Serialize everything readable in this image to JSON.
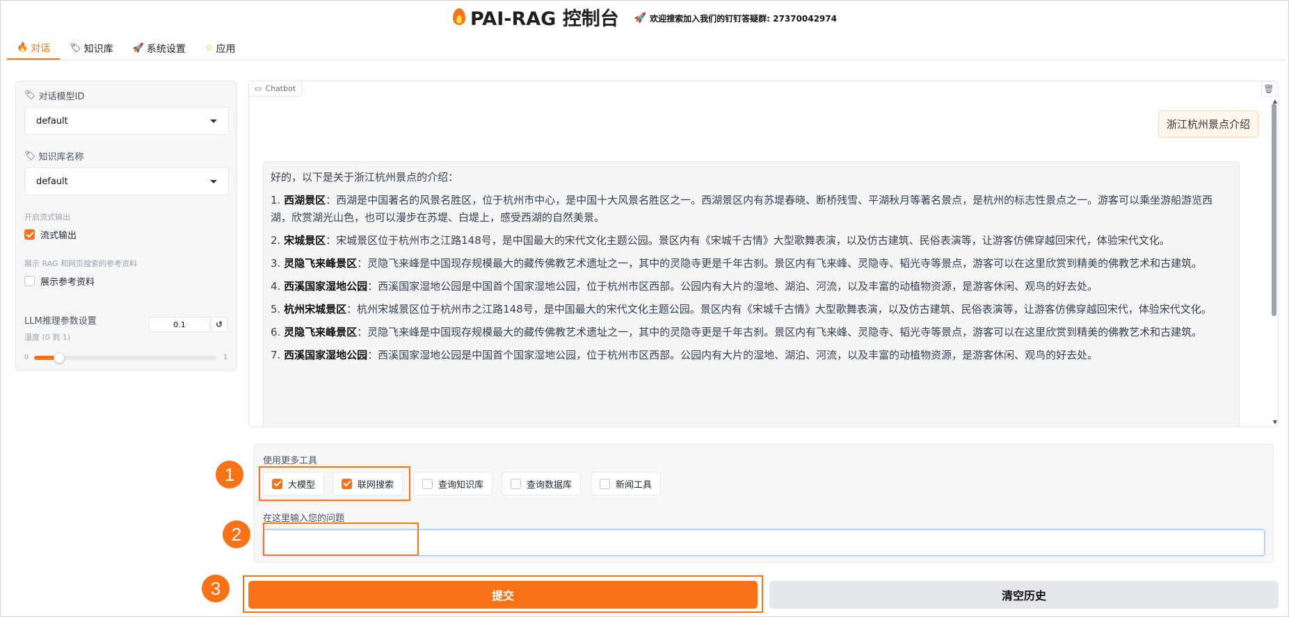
{
  "header": {
    "title": "PAI-RAG 控制台",
    "notice": "欢迎搜索加入我们的钉钉答疑群: 27370042974"
  },
  "tabs": [
    {
      "label": "对话",
      "icon": "flame-icon"
    },
    {
      "label": "知识库",
      "icon": "tag-icon"
    },
    {
      "label": "系统设置",
      "icon": "rocket-icon"
    },
    {
      "label": "应用",
      "icon": "star-icon"
    }
  ],
  "sidebar": {
    "model_label": "对话模型ID",
    "model_value": "default",
    "kb_label": "知识库名称",
    "kb_value": "default",
    "stream_section": "开启流式输出",
    "stream_label": "流式输出",
    "ref_section": "展示 RAG 和网页搜索的参考资料",
    "ref_label": "展示参考资料",
    "llm_label": "LLM推理参数设置",
    "temp_label": "温度 (0 到 1)",
    "temp_value": "0.1",
    "temp_min": "0",
    "temp_max": "1",
    "temp_level": 0.1
  },
  "chat": {
    "label": "Chatbot",
    "user_message": "浙江杭州景点介绍",
    "bot_intro": "好的，以下是关于浙江杭州景点的介绍：",
    "items": [
      {
        "num": "1.",
        "name": "西湖景区",
        "text": "：西湖是中国著名的风景名胜区，位于杭州市中心，是中国十大风景名胜区之一。西湖景区内有苏堤春晓、断桥残雪、平湖秋月等著名景点，是杭州的标志性景点之一。游客可以乘坐游船游览西湖，欣赏湖光山色，也可以漫步在苏堤、白堤上，感受西湖的自然美景。"
      },
      {
        "num": "2.",
        "name": "宋城景区",
        "text": "：宋城景区位于杭州市之江路148号，是中国最大的宋代文化主题公园。景区内有《宋城千古情》大型歌舞表演，以及仿古建筑、民俗表演等，让游客仿佛穿越回宋代，体验宋代文化。"
      },
      {
        "num": "3.",
        "name": "灵隐飞来峰景区",
        "text": "：灵隐飞来峰是中国现存规模最大的藏传佛教艺术遗址之一，其中的灵隐寺更是千年古刹。景区内有飞来峰、灵隐寺、韬光寺等景点，游客可以在这里欣赏到精美的佛教艺术和古建筑。"
      },
      {
        "num": "4.",
        "name": "西溪国家湿地公园",
        "text": "：西溪国家湿地公园是中国首个国家湿地公园，位于杭州市区西部。公园内有大片的湿地、湖泊、河流，以及丰富的动植物资源，是游客休闲、观鸟的好去处。"
      },
      {
        "num": "5.",
        "name": "杭州宋城景区",
        "text": "：杭州宋城景区位于杭州市之江路148号，是中国最大的宋代文化主题公园。景区内有《宋城千古情》大型歌舞表演，以及仿古建筑、民俗表演等，让游客仿佛穿越回宋代，体验宋代文化。"
      },
      {
        "num": "6.",
        "name": "灵隐飞来峰景区",
        "text": "：灵隐飞来峰是中国现存规模最大的藏传佛教艺术遗址之一，其中的灵隐寺更是千年古刹。景区内有飞来峰、灵隐寺、韬光寺等景点，游客可以在这里欣赏到精美的佛教艺术和古建筑。"
      },
      {
        "num": "7.",
        "name": "西溪国家湿地公园",
        "text": "：西溪国家湿地公园是中国首个国家湿地公园，位于杭州市区西部。公园内有大片的湿地、湖泊、河流，以及丰富的动植物资源，是游客休闲、观鸟的好去处。"
      }
    ]
  },
  "tools": {
    "title": "使用更多工具",
    "options": [
      {
        "label": "大模型",
        "checked": true
      },
      {
        "label": "联网搜索",
        "checked": true
      },
      {
        "label": "查询知识库",
        "checked": false
      },
      {
        "label": "查询数据库",
        "checked": false
      },
      {
        "label": "新闻工具",
        "checked": false
      }
    ],
    "input_label": "在这里输入您的问题",
    "input_value": ""
  },
  "actions": {
    "submit": "提交",
    "clear": "清空历史"
  },
  "annotations": [
    "1",
    "2",
    "3"
  ],
  "colors": {
    "accent": "#f97316",
    "user_bubble": "#fff7ed"
  }
}
